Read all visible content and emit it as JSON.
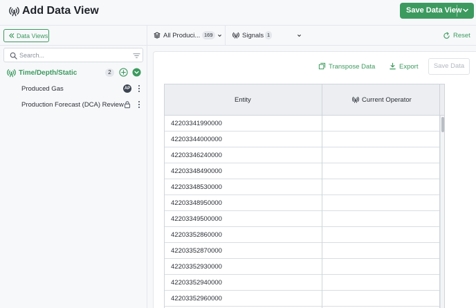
{
  "header": {
    "title": "Add Data View",
    "save_view_label": "Save Data View"
  },
  "sidebar": {
    "data_views_label": "Data Views",
    "search_placeholder": "Search...",
    "group": {
      "label": "Time/Depth/Static",
      "count": "2"
    },
    "items": [
      {
        "label": "Produced Gas",
        "avatar": "AP"
      },
      {
        "label": "Production Forecast (DCA) Review"
      }
    ]
  },
  "filterbar": {
    "entities_label": "All Produci...",
    "entities_count": "169",
    "signals_label": "Signals",
    "signals_count": "1",
    "reset_label": "Reset"
  },
  "toolbar": {
    "transpose_label": "Transpose Data",
    "export_label": "Export",
    "save_data_label": "Save Data"
  },
  "table": {
    "columns": [
      "Entity",
      "Current Operator"
    ],
    "rows": [
      [
        "42203341990000",
        ""
      ],
      [
        "42203344000000",
        ""
      ],
      [
        "42203346240000",
        ""
      ],
      [
        "42203348490000",
        ""
      ],
      [
        "42203348530000",
        ""
      ],
      [
        "42203348950000",
        ""
      ],
      [
        "42203349500000",
        ""
      ],
      [
        "42203352860000",
        ""
      ],
      [
        "42203352870000",
        ""
      ],
      [
        "42203352930000",
        ""
      ],
      [
        "42203352940000",
        ""
      ],
      [
        "42203352960000",
        ""
      ]
    ]
  },
  "colors": {
    "accent": "#3c9a5f",
    "text": "#2b2f36",
    "border": "#e3e6ea"
  }
}
